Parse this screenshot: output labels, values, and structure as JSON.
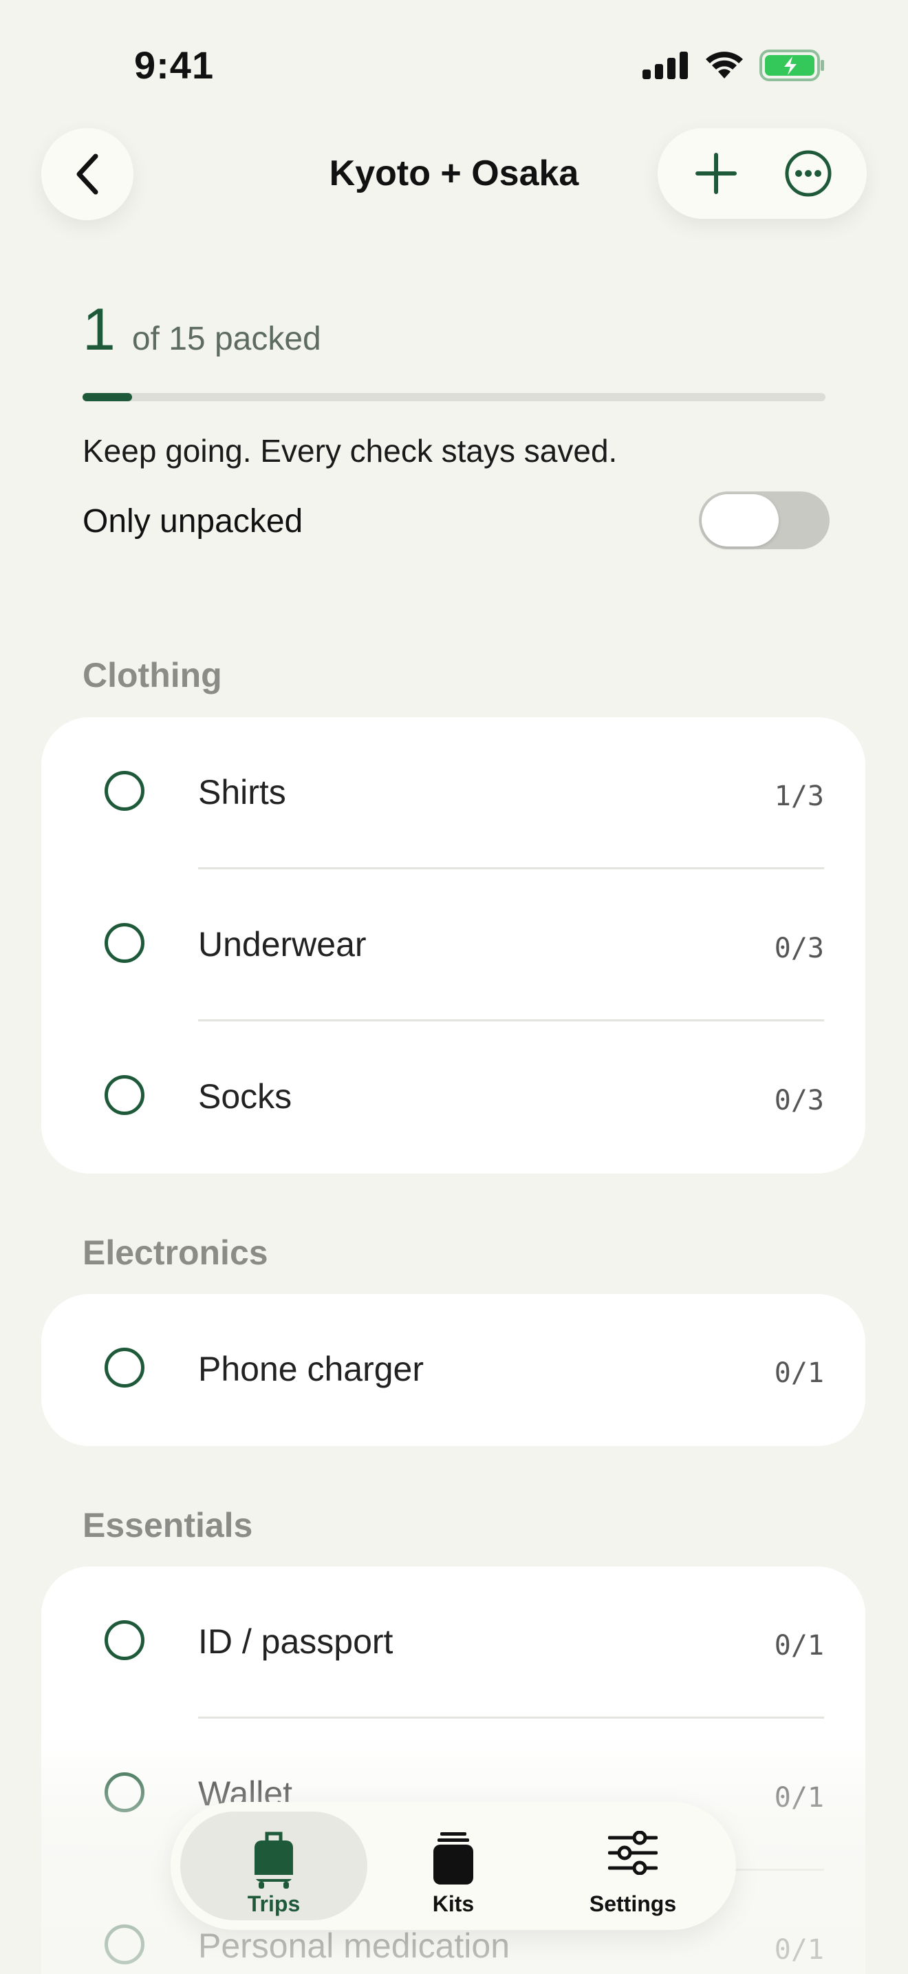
{
  "status_bar": {
    "time": "9:41"
  },
  "header": {
    "title": "Kyoto + Osaka"
  },
  "progress": {
    "packed": "1",
    "of_total": "of 15 packed",
    "fraction": 0.0667,
    "message": "Keep going. Every check stays saved."
  },
  "filter": {
    "label": "Only unpacked",
    "enabled": false
  },
  "sections": [
    {
      "title": "Clothing",
      "items": [
        {
          "name": "Shirts",
          "count": "1/3"
        },
        {
          "name": "Underwear",
          "count": "0/3"
        },
        {
          "name": "Socks",
          "count": "0/3"
        }
      ]
    },
    {
      "title": "Electronics",
      "items": [
        {
          "name": "Phone charger",
          "count": "0/1"
        }
      ]
    },
    {
      "title": "Essentials",
      "items": [
        {
          "name": "ID / passport",
          "count": "0/1"
        },
        {
          "name": "Wallet",
          "count": "0/1"
        },
        {
          "name": "Personal medication",
          "count": "0/1"
        }
      ]
    }
  ],
  "tabs": [
    {
      "label": "Trips",
      "icon": "suitcase-icon",
      "active": true
    },
    {
      "label": "Kits",
      "icon": "box-icon",
      "active": false
    },
    {
      "label": "Settings",
      "icon": "sliders-icon",
      "active": false
    }
  ],
  "colors": {
    "accent": "#1e5a3a",
    "background": "#f4f4ef",
    "card": "#ffffff"
  }
}
